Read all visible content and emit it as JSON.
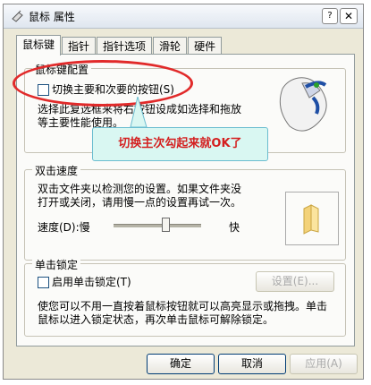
{
  "window": {
    "title": "鼠标 属性",
    "help_label": "?",
    "close_label": "✕"
  },
  "tabs": [
    {
      "label": "鼠标键"
    },
    {
      "label": "指针"
    },
    {
      "label": "指针选项"
    },
    {
      "label": "滑轮"
    },
    {
      "label": "硬件"
    }
  ],
  "button_config": {
    "legend": "鼠标键配置",
    "checkbox_label": "切换主要和次要的按钮(S)",
    "description_line1": "选择此复选框来将右按钮设成如选择和拖放",
    "description_line2": "等主要性能使用。"
  },
  "annotation": {
    "callout_text": "切换主次勾起来就OK了"
  },
  "double_click": {
    "legend": "双击速度",
    "description_line1": "双击文件夹以检测您的设置。如果文件夹没",
    "description_line2": "打开或关闭，请用慢一点的设置再试一次。",
    "speed_label": "速度(D):慢",
    "fast_label": "快",
    "speed_level": 0.6
  },
  "click_lock": {
    "legend": "单击锁定",
    "checkbox_label": "启用单击锁定(T)",
    "settings_button": "设置(E)...",
    "description_line1": "使您可以不用一直按着鼠标按钮就可以高亮显示或拖拽。单击",
    "description_line2": "鼠标以进入锁定状态，再次单击鼠标可解除锁定。"
  },
  "footer": {
    "ok": "确定",
    "cancel": "取消",
    "apply": "应用(A)"
  },
  "colors": {
    "annotation_red": "#e12a2a",
    "callout_bg": "#d9f7f2"
  }
}
